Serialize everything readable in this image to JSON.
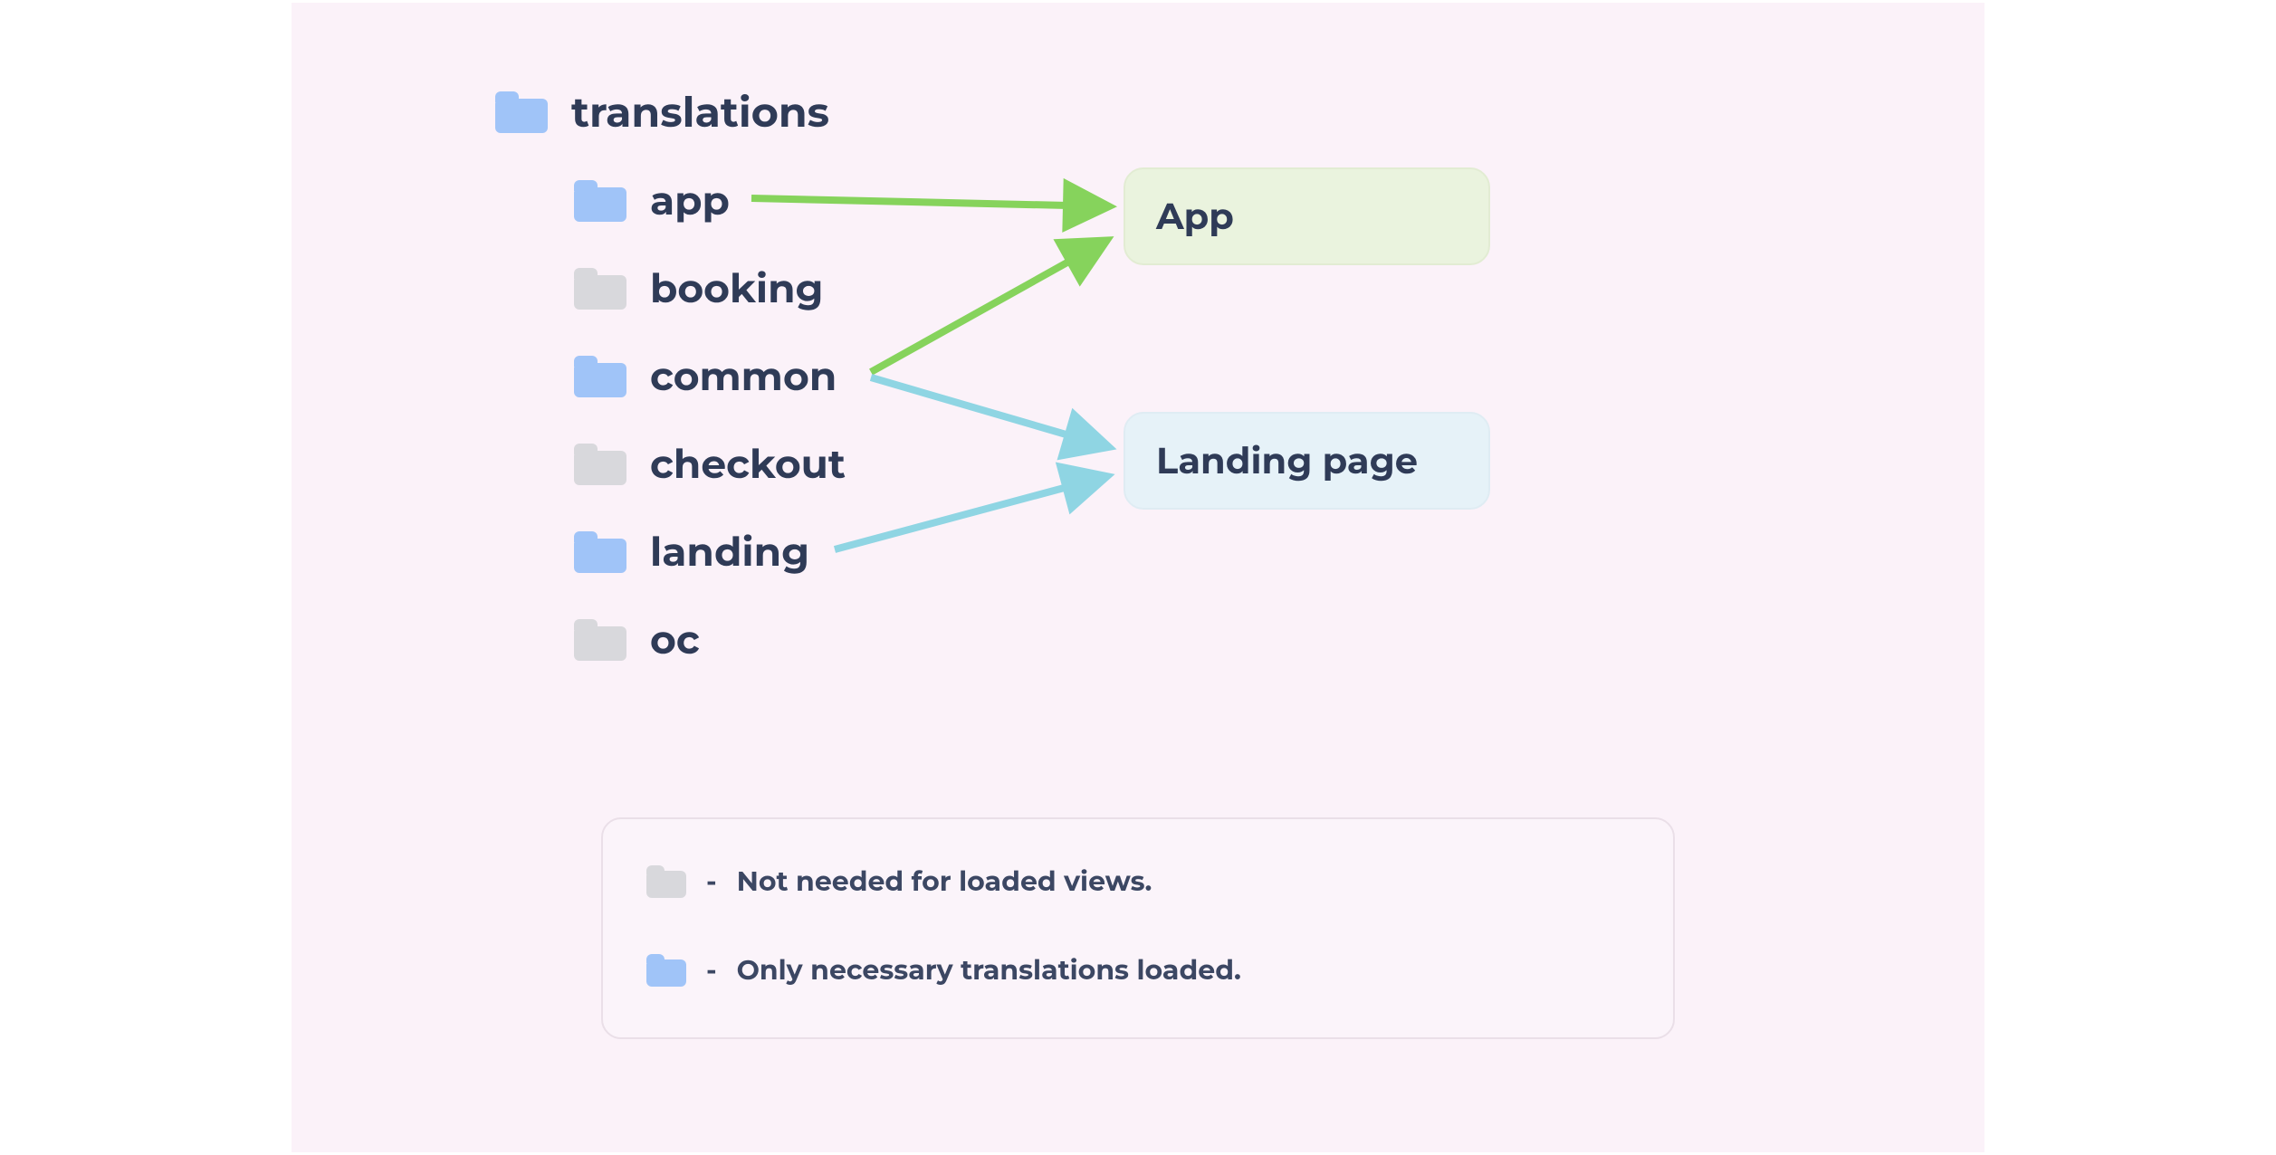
{
  "root": {
    "label": "translations",
    "color": "blue"
  },
  "folders": [
    {
      "name": "app",
      "color": "blue"
    },
    {
      "name": "booking",
      "color": "grey"
    },
    {
      "name": "common",
      "color": "blue"
    },
    {
      "name": "checkout",
      "color": "grey"
    },
    {
      "name": "landing",
      "color": "blue"
    },
    {
      "name": "oc",
      "color": "grey"
    }
  ],
  "targets": {
    "app": {
      "label": "App"
    },
    "landing": {
      "label": "Landing page"
    }
  },
  "arrows": [
    {
      "from": "app",
      "to": "app",
      "color": "#86d35c"
    },
    {
      "from": "common",
      "to": "app",
      "color": "#86d35c"
    },
    {
      "from": "common",
      "to": "landing",
      "color": "#8fd5e3"
    },
    {
      "from": "landing",
      "to": "landing",
      "color": "#8fd5e3"
    }
  ],
  "legend": {
    "grey": "Not needed for loaded views.",
    "blue": "Only necessary translations loaded."
  },
  "colors": {
    "folder_active": "#a0c4f8",
    "folder_inactive": "#d8d8dc",
    "background": "#fbf2f9",
    "text": "#2f3b57",
    "arrow_green": "#86d35c",
    "arrow_teal": "#8fd5e3",
    "target_app_bg": "#eaf3de",
    "target_landing_bg": "#e6f2f8"
  }
}
